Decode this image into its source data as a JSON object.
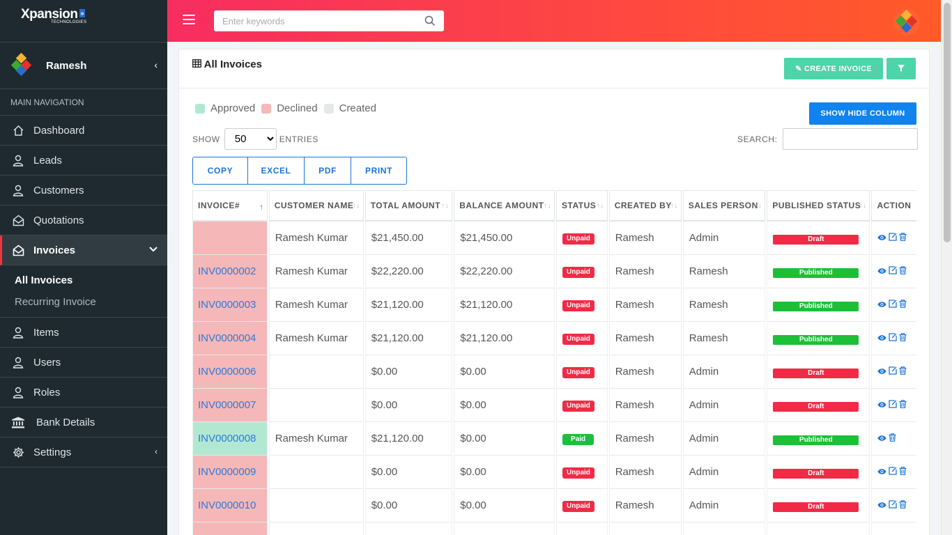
{
  "brand": {
    "name": "Xpansion",
    "sub": "TECHNOLOGIES",
    "chevrons": "»"
  },
  "user": {
    "name": "Ramesh",
    "collapse_glyph": "‹"
  },
  "nav": {
    "heading": "MAIN NAVIGATION",
    "items": [
      {
        "label": "Dashboard",
        "icon": "home-icon"
      },
      {
        "label": "Leads",
        "icon": "user-icon"
      },
      {
        "label": "Customers",
        "icon": "user-icon"
      },
      {
        "label": "Quotations",
        "icon": "envelope-icon"
      },
      {
        "label": "Invoices",
        "icon": "envelope-icon"
      },
      {
        "label": "Items",
        "icon": "user-icon"
      },
      {
        "label": "Users",
        "icon": "user-icon"
      },
      {
        "label": "Roles",
        "icon": "user-icon"
      },
      {
        "label": "Bank Details",
        "icon": "bank-icon"
      },
      {
        "label": "Settings",
        "icon": "gear-icon"
      }
    ],
    "sub_items": [
      "All Invoices",
      "Recurring Invoice"
    ],
    "expand_glyph": "⌄",
    "collapse_glyph": "‹"
  },
  "topbar": {
    "search_placeholder": "Enter keywords"
  },
  "page": {
    "title": "All Invoices",
    "create_button": "CREATE INVOICE",
    "show_hide_button": "SHOW HIDE COLUMN",
    "legend": [
      {
        "label": "Approved",
        "color": "#b2e8d2"
      },
      {
        "label": "Declined",
        "color": "#f5b7b8"
      },
      {
        "label": "Created",
        "color": "#e6e7e9"
      }
    ],
    "show_label": "SHOW",
    "entries_value": "50",
    "entries_label": "ENTRIES",
    "search_label": "SEARCH:",
    "export_buttons": [
      "COPY",
      "EXCEL",
      "PDF",
      "PRINT"
    ]
  },
  "table": {
    "headers": [
      "INVOICE#",
      "CUSTOMER NAME",
      "TOTAL AMOUNT",
      "BALANCE AMOUNT",
      "STATUS",
      "CREATED BY",
      "SALES PERSON",
      "PUBLISHED STATUS",
      "ACTION"
    ],
    "sort_glyphs": {
      "asc": "↑",
      "both": "↑↓"
    },
    "rows": [
      {
        "invoice": "",
        "row_state": "declined",
        "customer": "Ramesh Kumar",
        "total": "$21,450.00",
        "balance": "$21,450.00",
        "status": "Unpaid",
        "created_by": "Ramesh",
        "sales_person": "Admin",
        "published": "Draft",
        "editable": true
      },
      {
        "invoice": "INV0000002",
        "row_state": "declined",
        "customer": "Ramesh Kumar",
        "total": "$22,220.00",
        "balance": "$22,220.00",
        "status": "Unpaid",
        "created_by": "Ramesh",
        "sales_person": "Ramesh",
        "published": "Published",
        "editable": true
      },
      {
        "invoice": "INV0000003",
        "row_state": "declined",
        "customer": "Ramesh Kumar",
        "total": "$21,120.00",
        "balance": "$21,120.00",
        "status": "Unpaid",
        "created_by": "Ramesh",
        "sales_person": "Ramesh",
        "published": "Published",
        "editable": true
      },
      {
        "invoice": "INV0000004",
        "row_state": "declined",
        "customer": "Ramesh Kumar",
        "total": "$21,120.00",
        "balance": "$21,120.00",
        "status": "Unpaid",
        "created_by": "Ramesh",
        "sales_person": "Ramesh",
        "published": "Published",
        "editable": true
      },
      {
        "invoice": "INV0000006",
        "row_state": "declined",
        "customer": "",
        "total": "$0.00",
        "balance": "$0.00",
        "status": "Unpaid",
        "created_by": "Ramesh",
        "sales_person": "Admin",
        "published": "Draft",
        "editable": true
      },
      {
        "invoice": "INV0000007",
        "row_state": "declined",
        "customer": "",
        "total": "$0.00",
        "balance": "$0.00",
        "status": "Unpaid",
        "created_by": "Ramesh",
        "sales_person": "Admin",
        "published": "Draft",
        "editable": true
      },
      {
        "invoice": "INV0000008",
        "row_state": "approved",
        "customer": "Ramesh Kumar",
        "total": "$21,120.00",
        "balance": "$0.00",
        "status": "Paid",
        "created_by": "Ramesh",
        "sales_person": "Admin",
        "published": "Published",
        "editable": false
      },
      {
        "invoice": "INV0000009",
        "row_state": "declined",
        "customer": "",
        "total": "$0.00",
        "balance": "$0.00",
        "status": "Unpaid",
        "created_by": "Ramesh",
        "sales_person": "Admin",
        "published": "Draft",
        "editable": true
      },
      {
        "invoice": "INV0000010",
        "row_state": "declined",
        "customer": "",
        "total": "$0.00",
        "balance": "$0.00",
        "status": "Unpaid",
        "created_by": "Ramesh",
        "sales_person": "Admin",
        "published": "Draft",
        "editable": true
      }
    ]
  },
  "colors": {
    "sidebar_bg": "#1e2a30",
    "topbar_gradient": [
      "#f72d61",
      "#ff5a28"
    ],
    "accent_green": "#4dd4a9",
    "accent_blue": "#0f83ef",
    "badge_red": "#f22a46",
    "badge_green": "#1dbf37",
    "link_blue": "#2c7bd6"
  }
}
